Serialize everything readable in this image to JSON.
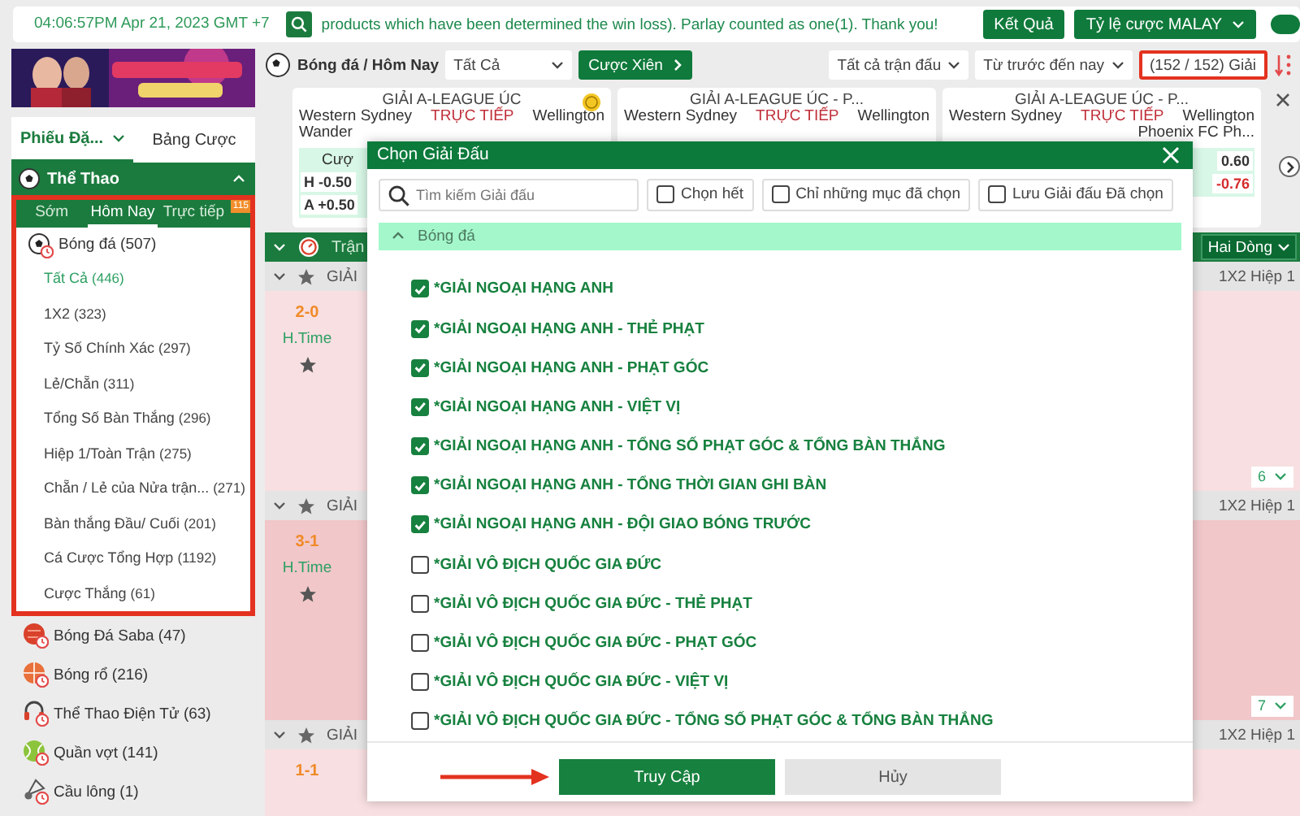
{
  "top_bar": {
    "clock": "04:06:57PM Apr 21, 2023 GMT +7",
    "notice": "products which have been determined the win loss). Parlay counted as one(1). Thank you!",
    "buttons": [
      {
        "label": "Kết Quả",
        "kind": "button"
      },
      {
        "label": "Tỷ lệ cược MALAY",
        "kind": "dropdown"
      }
    ],
    "toggle": {
      "on": true
    }
  },
  "sidebar": {
    "tabs": [
      {
        "label": "Phiếu Đặ...",
        "selected": true,
        "dropdown": true
      },
      {
        "label": "Bảng Cược",
        "selected": false,
        "dropdown": false
      }
    ],
    "section": {
      "title": "Thể Thao",
      "expanded": true
    },
    "period_tabs": [
      {
        "label": "Sớm",
        "selected": false
      },
      {
        "label": "Hôm Nay",
        "selected": true
      },
      {
        "label": "Trực tiếp",
        "selected": false,
        "badge": "115"
      }
    ],
    "highlighted": true,
    "sports": [
      {
        "label": "Bóng đá (507)",
        "kind": "soccer",
        "children": [
          {
            "label": "Tất Cả",
            "count": "(446)",
            "selected": true
          },
          {
            "label": "1X2",
            "count": "(323)",
            "selected": false
          },
          {
            "label": "Tỷ Số Chính Xác",
            "count": "(297)",
            "selected": false
          },
          {
            "label": "Lẻ/Chẵn",
            "count": "(311)",
            "selected": false
          },
          {
            "label": "Tổng Số Bàn Thắng",
            "count": "(296)",
            "selected": false
          },
          {
            "label": "Hiệp 1/Toàn Trận",
            "count": "(275)",
            "selected": false
          },
          {
            "label": "Chẵn / Lẻ của Nửa trận...",
            "count": "(271)",
            "selected": false
          },
          {
            "label": "Bàn thắng Đầu/ Cuối",
            "count": "(201)",
            "selected": false
          },
          {
            "label": "Cá Cược Tổng Hợp",
            "count": "(1192)",
            "selected": false
          },
          {
            "label": "Cược Thắng",
            "count": "(61)",
            "selected": false
          }
        ]
      },
      {
        "label": "Bóng Đá Saba (47)",
        "kind": "saba"
      },
      {
        "label": "Bóng rổ (216)",
        "kind": "basketball"
      },
      {
        "label": "Thể Thao Điện Tử (63)",
        "kind": "esports"
      },
      {
        "label": "Quần vợt (141)",
        "kind": "tennis"
      },
      {
        "label": "Cầu lông (1)",
        "kind": "badminton"
      }
    ]
  },
  "toolbar": {
    "breadcrumb": "Bóng đá / Hôm Nay",
    "market_select": "Tất Cả",
    "parlay_button": "Cược Xiên",
    "filters": [
      "Tất cả trận đấu",
      "Từ trước đến nay"
    ],
    "league_count": "(152 / 152) Giải",
    "league_count_highlighted": true
  },
  "cards": [
    {
      "league": "GIẢI A-LEAGUE ÚC",
      "home": "Western Sydney",
      "status": "TRỰC TIẾP",
      "away": "Wellington",
      "home_2": "Wander",
      "odds_header": "Cượ",
      "odds": [
        {
          "value": "H -0.50",
          "negative": false
        },
        {
          "value": "A +0.50",
          "negative": false
        }
      ]
    },
    {
      "league": "GIẢI A-LEAGUE ÚC - P...",
      "home": "Western Sydney",
      "status": "TRỰC TIẾP",
      "away": "Wellington"
    },
    {
      "league": "GIẢI A-LEAGUE ÚC - P...",
      "home": "Western Sydney",
      "status": "TRỰC TIẾP",
      "away": "Wellington",
      "away_2": "Phoenix FC Ph...",
      "odds": [
        {
          "value": "0.60",
          "negative": false
        },
        {
          "value": "-0.76",
          "negative": true
        }
      ]
    }
  ],
  "table": {
    "header": "Trận",
    "view": "Hai Dòng",
    "leagues": [
      {
        "name": "GIẢI",
        "market": "1X2 Hiệp 1",
        "score": "2-0",
        "period": "H.Time",
        "page": "6"
      },
      {
        "name": "GIẢI",
        "market": "1X2 Hiệp 1",
        "score": "3-1",
        "period": "H.Time",
        "page": "7"
      },
      {
        "name": "GIẢI",
        "market": "1X2 Hiệp 1",
        "score": "1-1"
      }
    ]
  },
  "dialog": {
    "title": "Chọn Giải Đấu",
    "search_placeholder": "Tìm kiếm Giải đấu",
    "options": [
      {
        "label": "Chọn hết",
        "checked": false
      },
      {
        "label": "Chỉ những mục đã chọn",
        "checked": false
      },
      {
        "label": "Lưu Giải đấu Đã chọn",
        "checked": false
      }
    ],
    "group": {
      "label": "Bóng đá",
      "expanded": true
    },
    "leagues": [
      {
        "label": "*GIẢI NGOẠI HẠNG ANH",
        "checked": true
      },
      {
        "label": "*GIẢI NGOẠI HẠNG ANH - THẺ PHẠT",
        "checked": true
      },
      {
        "label": "*GIẢI NGOẠI HẠNG ANH - PHẠT GÓC",
        "checked": true
      },
      {
        "label": "*GIẢI NGOẠI HẠNG ANH - VIỆT VỊ",
        "checked": true
      },
      {
        "label": "*GIẢI NGOẠI HẠNG ANH - TỔNG SỐ PHẠT GÓC & TỔNG BÀN THẮNG",
        "checked": true
      },
      {
        "label": "*GIẢI NGOẠI HẠNG ANH - TỔNG THỜI GIAN GHI BÀN",
        "checked": true
      },
      {
        "label": "*GIẢI NGOẠI HẠNG ANH - ĐỘI GIAO BÓNG TRƯỚC",
        "checked": true
      },
      {
        "label": "*GIẢI VÔ ĐỊCH QUỐC GIA ĐỨC",
        "checked": false
      },
      {
        "label": "*GIẢI VÔ ĐỊCH QUỐC GIA ĐỨC - THẺ PHẠT",
        "checked": false
      },
      {
        "label": "*GIẢI VÔ ĐỊCH QUỐC GIA ĐỨC - PHẠT GÓC",
        "checked": false
      },
      {
        "label": "*GIẢI VÔ ĐỊCH QUỐC GIA ĐỨC - VIỆT VỊ",
        "checked": false
      },
      {
        "label": "*GIẢI VÔ ĐỊCH QUỐC GIA ĐỨC - TỔNG SỐ PHẠT GÓC & TỔNG BÀN THẮNG",
        "checked": false
      }
    ],
    "buttons": [
      {
        "label": "Truy Cập",
        "kind": "primary",
        "pointed_at": true
      },
      {
        "label": "Hủy",
        "kind": "secondary",
        "pointed_at": false
      }
    ]
  }
}
